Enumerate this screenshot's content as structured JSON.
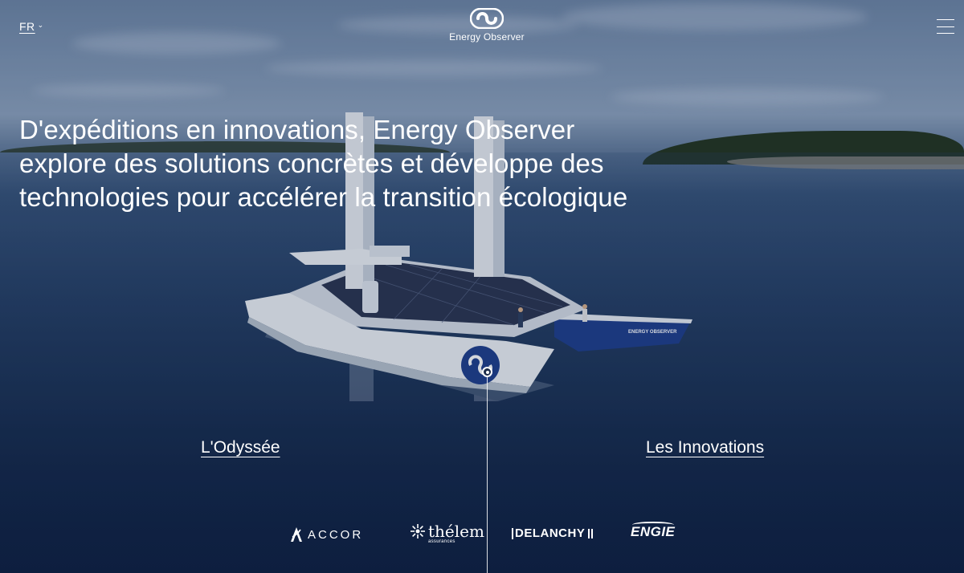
{
  "header": {
    "language": "FR",
    "brand_name": "Energy Observer",
    "icons": {
      "language_dropdown": "chevron-down-icon",
      "logo": "infinity-logo-icon",
      "menu": "hamburger-menu-icon"
    }
  },
  "hero": {
    "headline": "D'expéditions en innovations, Energy Observer explore des solutions concrètes et développe des technologies pour accélérer la transition écologique",
    "boat_hull_text": "ENERGY OBSERVER"
  },
  "nav": {
    "left_link": "L'Odyssée",
    "right_link": "Les Innovations"
  },
  "partners": [
    {
      "name": "ACCOR",
      "icon": "accor-logo-icon"
    },
    {
      "name": "thélem",
      "sub": "assurances",
      "icon": "thelem-logo-icon"
    },
    {
      "name": "DELANCHY",
      "icon": "delanchy-logo-icon"
    },
    {
      "name": "ENGIE",
      "icon": "engie-logo-icon"
    }
  ],
  "colors": {
    "text": "#ffffff",
    "water_dark": "#13264a",
    "sky": "#8ea3bd",
    "boat_hull_blue": "#1f3f8c"
  }
}
